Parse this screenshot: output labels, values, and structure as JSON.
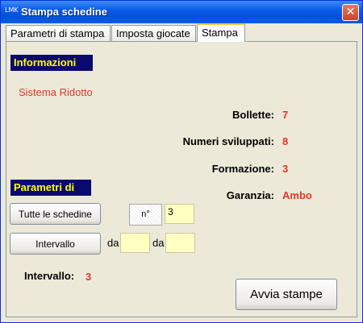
{
  "window": {
    "icon_text": "LMK",
    "title": "Stampa schedine",
    "close_glyph": "✕"
  },
  "tabs": [
    {
      "label": "Parametri di stampa"
    },
    {
      "label": "Imposta giocate"
    },
    {
      "label": "Stampa",
      "active": true
    }
  ],
  "info": {
    "header": "Informazioni",
    "system": "Sistema Ridotto",
    "rows": [
      {
        "label": "Bollette:",
        "value": "7"
      },
      {
        "label": "Numeri sviluppati:",
        "value": "8"
      },
      {
        "label": "Formazione:",
        "value": "3"
      },
      {
        "label": "Garanzia:",
        "value": "Ambo"
      }
    ]
  },
  "print_params": {
    "header": "Parametri di",
    "all_button": "Tutte le schedine",
    "n_label": "n°",
    "n_value": "3",
    "interval_button": "Intervallo",
    "from_label": "da",
    "from_value": "",
    "to_label": "da",
    "to_value": "",
    "interval_label": "Intervallo:",
    "interval_value": "3"
  },
  "actions": {
    "start_print": "Avvia stampe"
  },
  "colors": {
    "accent_red": "#e5352a",
    "header_bg": "#0a0a6e",
    "header_fg": "#ffff00",
    "field_bg": "#ffffc0"
  }
}
